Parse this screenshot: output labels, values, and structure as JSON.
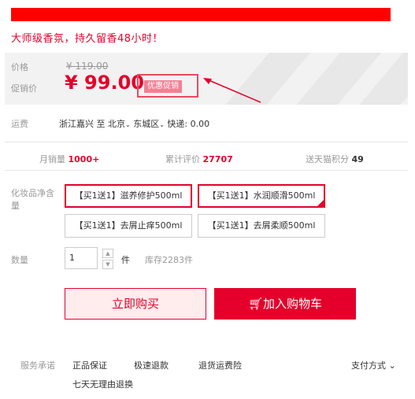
{
  "slogan": "大师级香氛，持久留香48小时！",
  "price": {
    "label": "价格",
    "original": "¥ 119.00",
    "promo_label": "促销价",
    "current": "¥ 99.00",
    "promo_tag": "优惠促销"
  },
  "shipping": {
    "label": "运费",
    "from": "浙江嘉兴",
    "to_word": "至",
    "city": "北京",
    "district": "东城区",
    "express": "快递: 0.00"
  },
  "stats": {
    "monthly_label": "月销量",
    "monthly_value": "1000+",
    "reviews_label": "累计评价",
    "reviews_value": "27707",
    "points_label": "送天猫积分",
    "points_value": "49"
  },
  "spec": {
    "label": "化妆品净含量",
    "options": [
      "【买1送1】滋养修护500ml",
      "【买1送1】水润顺滑500ml",
      "【买1送1】去屑止痒500ml",
      "【买1送1】去屑柔顺500ml"
    ],
    "check": "✓"
  },
  "quantity": {
    "label": "数量",
    "value": "1",
    "unit": "件",
    "stock": "库存2283件",
    "up": "▲",
    "down": "▼"
  },
  "buttons": {
    "buy": "立即购买",
    "cart": "加入购物车",
    "cart_icon": "🛒︎"
  },
  "services": {
    "label": "服务承诺",
    "items": [
      "正品保证",
      "极速退款",
      "退货运费险",
      "七天无理由退换"
    ],
    "payment": "支付方式",
    "payment_arrow": "⌄"
  },
  "colors": {
    "accent": "#e4002b",
    "promo_tag": "#f28095",
    "panel": "#f2f2f2"
  }
}
